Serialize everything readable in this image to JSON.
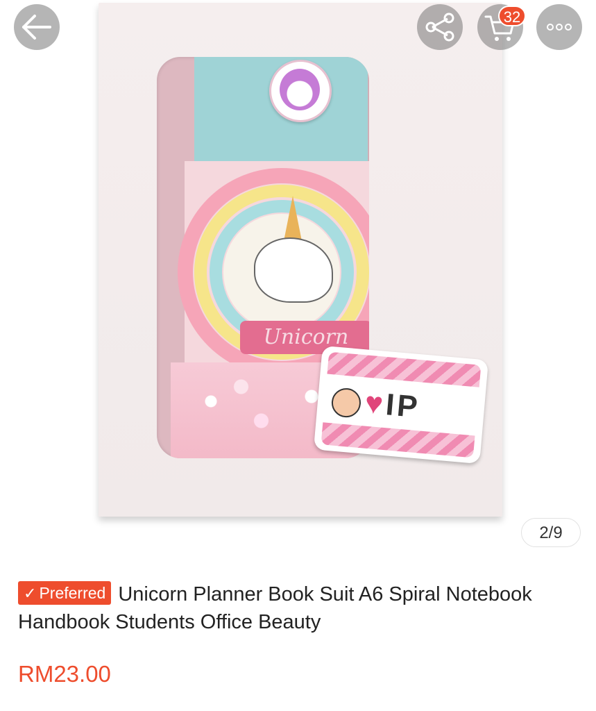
{
  "gallery": {
    "page_indicator": "2/9",
    "window_text": "Unicorn"
  },
  "topbar": {
    "back_icon": "arrow-left-icon",
    "share_icon": "share-icon",
    "cart_icon": "cart-icon",
    "cart_count": "32",
    "more_icon": "more-dots-icon"
  },
  "product": {
    "tag_label": "Preferred",
    "title": "Unicorn Planner Book Suit A6 Spiral Notebook Handbook Students Office Beauty",
    "price": "RM23.00"
  },
  "colors": {
    "accent": "#ee4d2d"
  }
}
